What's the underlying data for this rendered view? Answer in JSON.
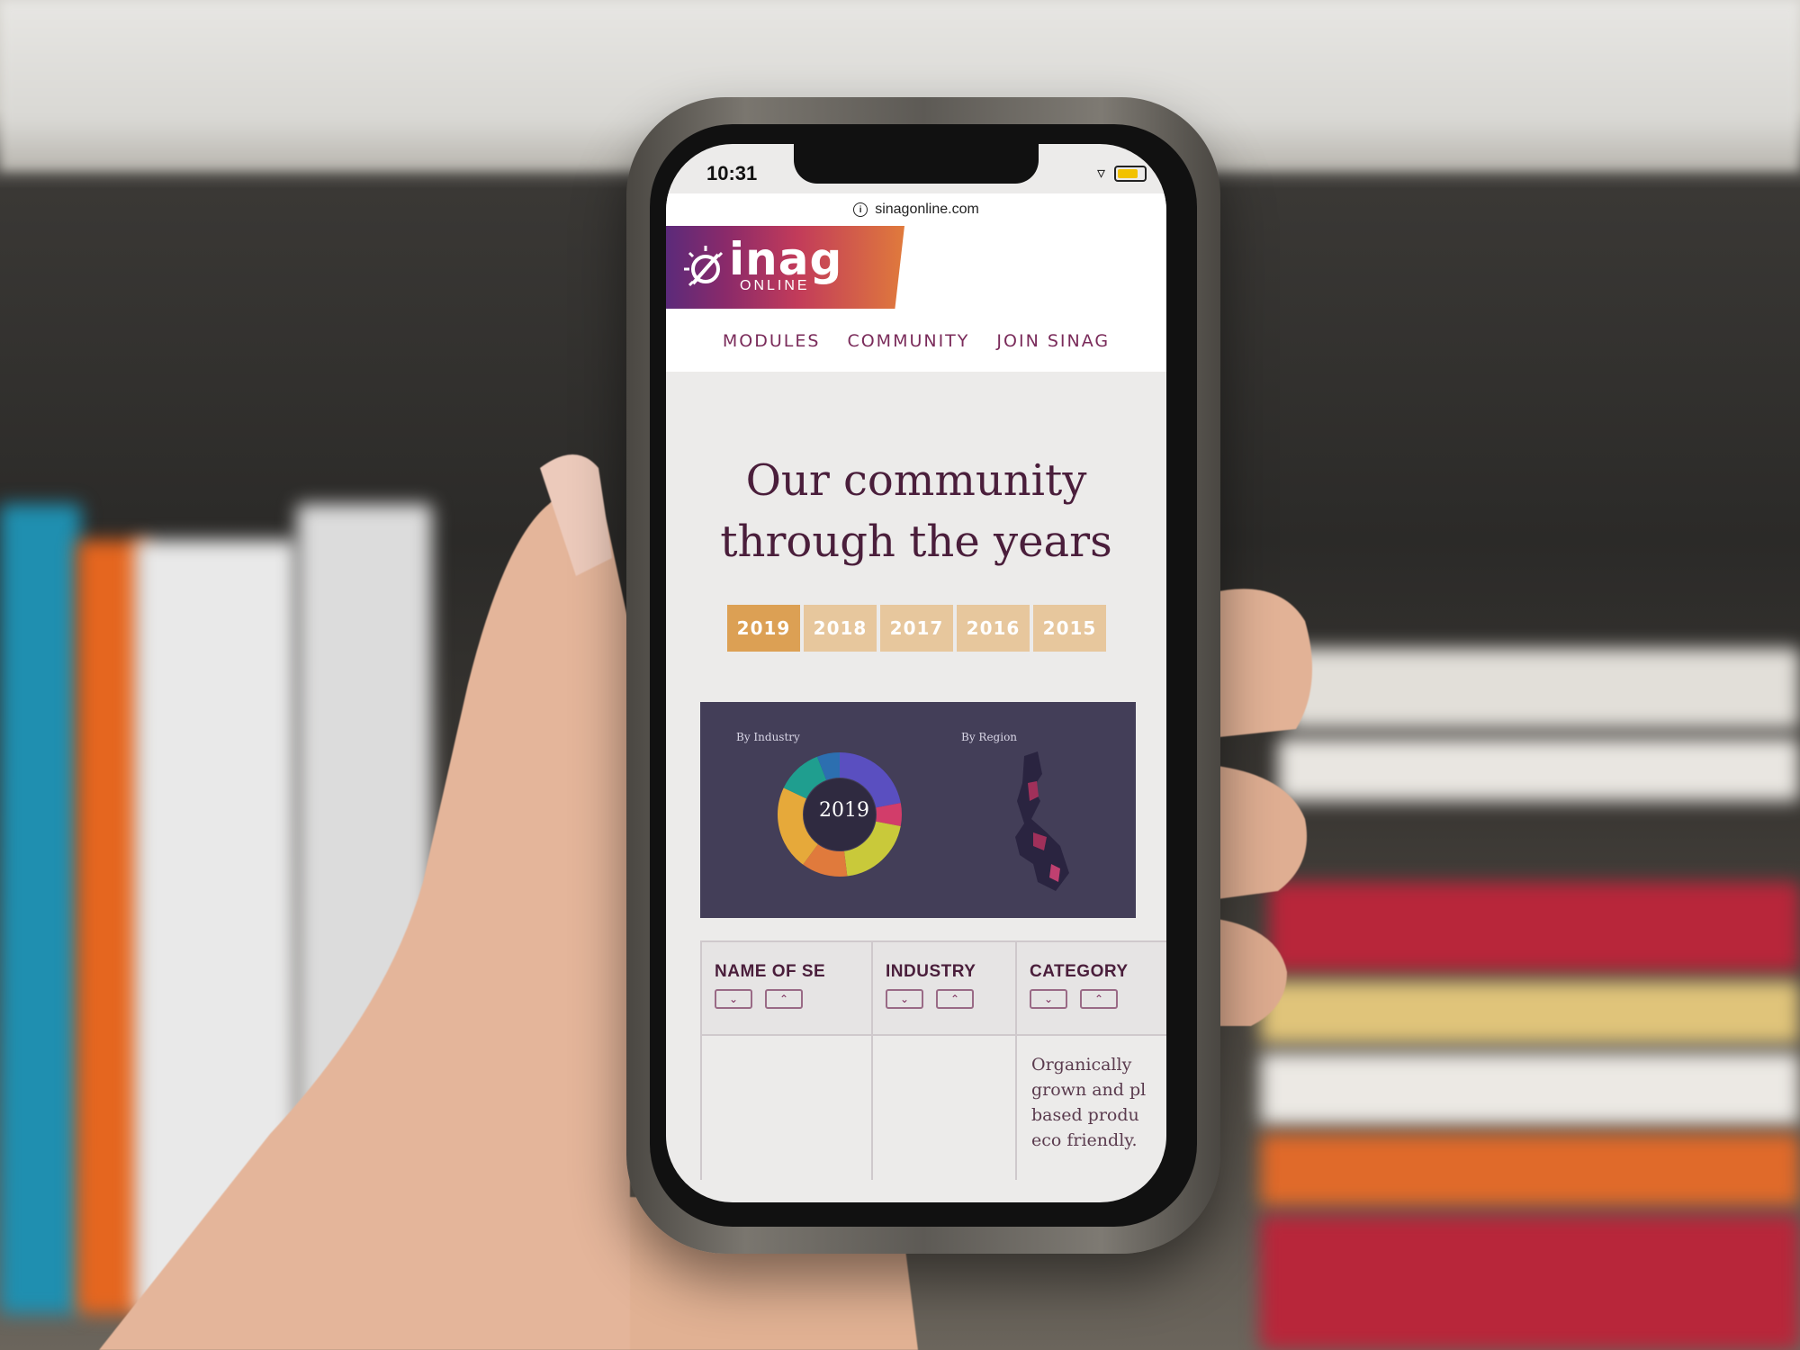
{
  "status": {
    "time": "10:31"
  },
  "browser": {
    "url": "sinagonline.com"
  },
  "logo": {
    "word": "inag",
    "sub": "ONLINE"
  },
  "nav": {
    "items": [
      "MODULES",
      "COMMUNITY",
      "JOIN SINAG"
    ]
  },
  "hero": {
    "title_line1": "Our community",
    "title_line2": "through the years"
  },
  "years": [
    "2019",
    "2018",
    "2017",
    "2016",
    "2015"
  ],
  "active_year": "2019",
  "chart": {
    "industry_label": "By Industry",
    "region_label": "By Region",
    "center_label": "2019",
    "industry_colors": [
      "#5a4fc0",
      "#d23d6a",
      "#c9c93a",
      "#e07a3c",
      "#e6a93a",
      "#1f9e8f",
      "#2c6fb0"
    ]
  },
  "table": {
    "headers": [
      "NAME OF SE",
      "INDUSTRY",
      "CATEGORY"
    ],
    "row1": {
      "category": "Organically\ngrown and pl\nbased produ\neco friendly."
    }
  },
  "colors": {
    "accent": "#7a2b5a",
    "year_active": "#dca054",
    "year_inactive": "#e7c79d",
    "chart_bg": "#433e58"
  }
}
